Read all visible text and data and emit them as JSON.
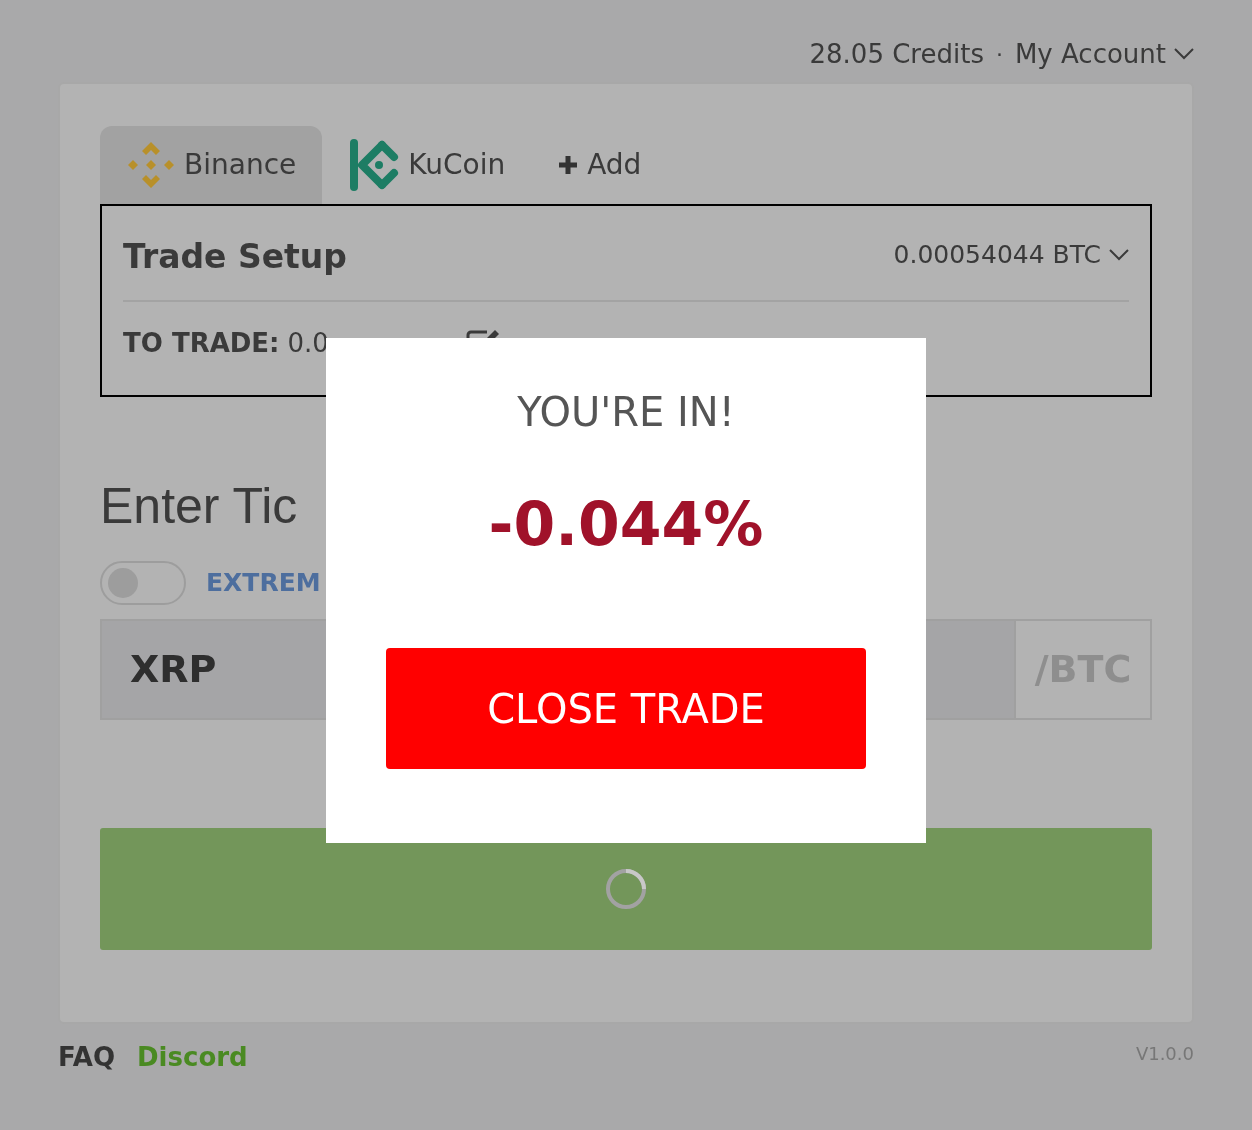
{
  "header": {
    "credits": "28.05 Credits",
    "separator": "·",
    "account": "My Account"
  },
  "exchange_tabs": [
    {
      "kind": "binance",
      "label": "Binance",
      "selected": true
    },
    {
      "kind": "kucoin",
      "label": "KuCoin",
      "selected": false
    },
    {
      "kind": "add",
      "label": "Add",
      "selected": false
    }
  ],
  "trade_setup": {
    "title": "Trade Setup",
    "balance": "0.00054044 BTC",
    "to_trade_label": "TO TRADE:",
    "to_trade_value": "0.0"
  },
  "ticker": {
    "heading": "Enter Tic",
    "toggle": {
      "on": false,
      "label": "EXTREM"
    },
    "value": "XRP",
    "quote": "/BTC"
  },
  "submit_button": {
    "loading": true
  },
  "modal": {
    "title": "YOU'RE IN!",
    "result": "-0.044%",
    "button": "CLOSE TRADE"
  },
  "footer": {
    "links": [
      "FAQ",
      "Discord"
    ],
    "version": "V1.0.0"
  }
}
